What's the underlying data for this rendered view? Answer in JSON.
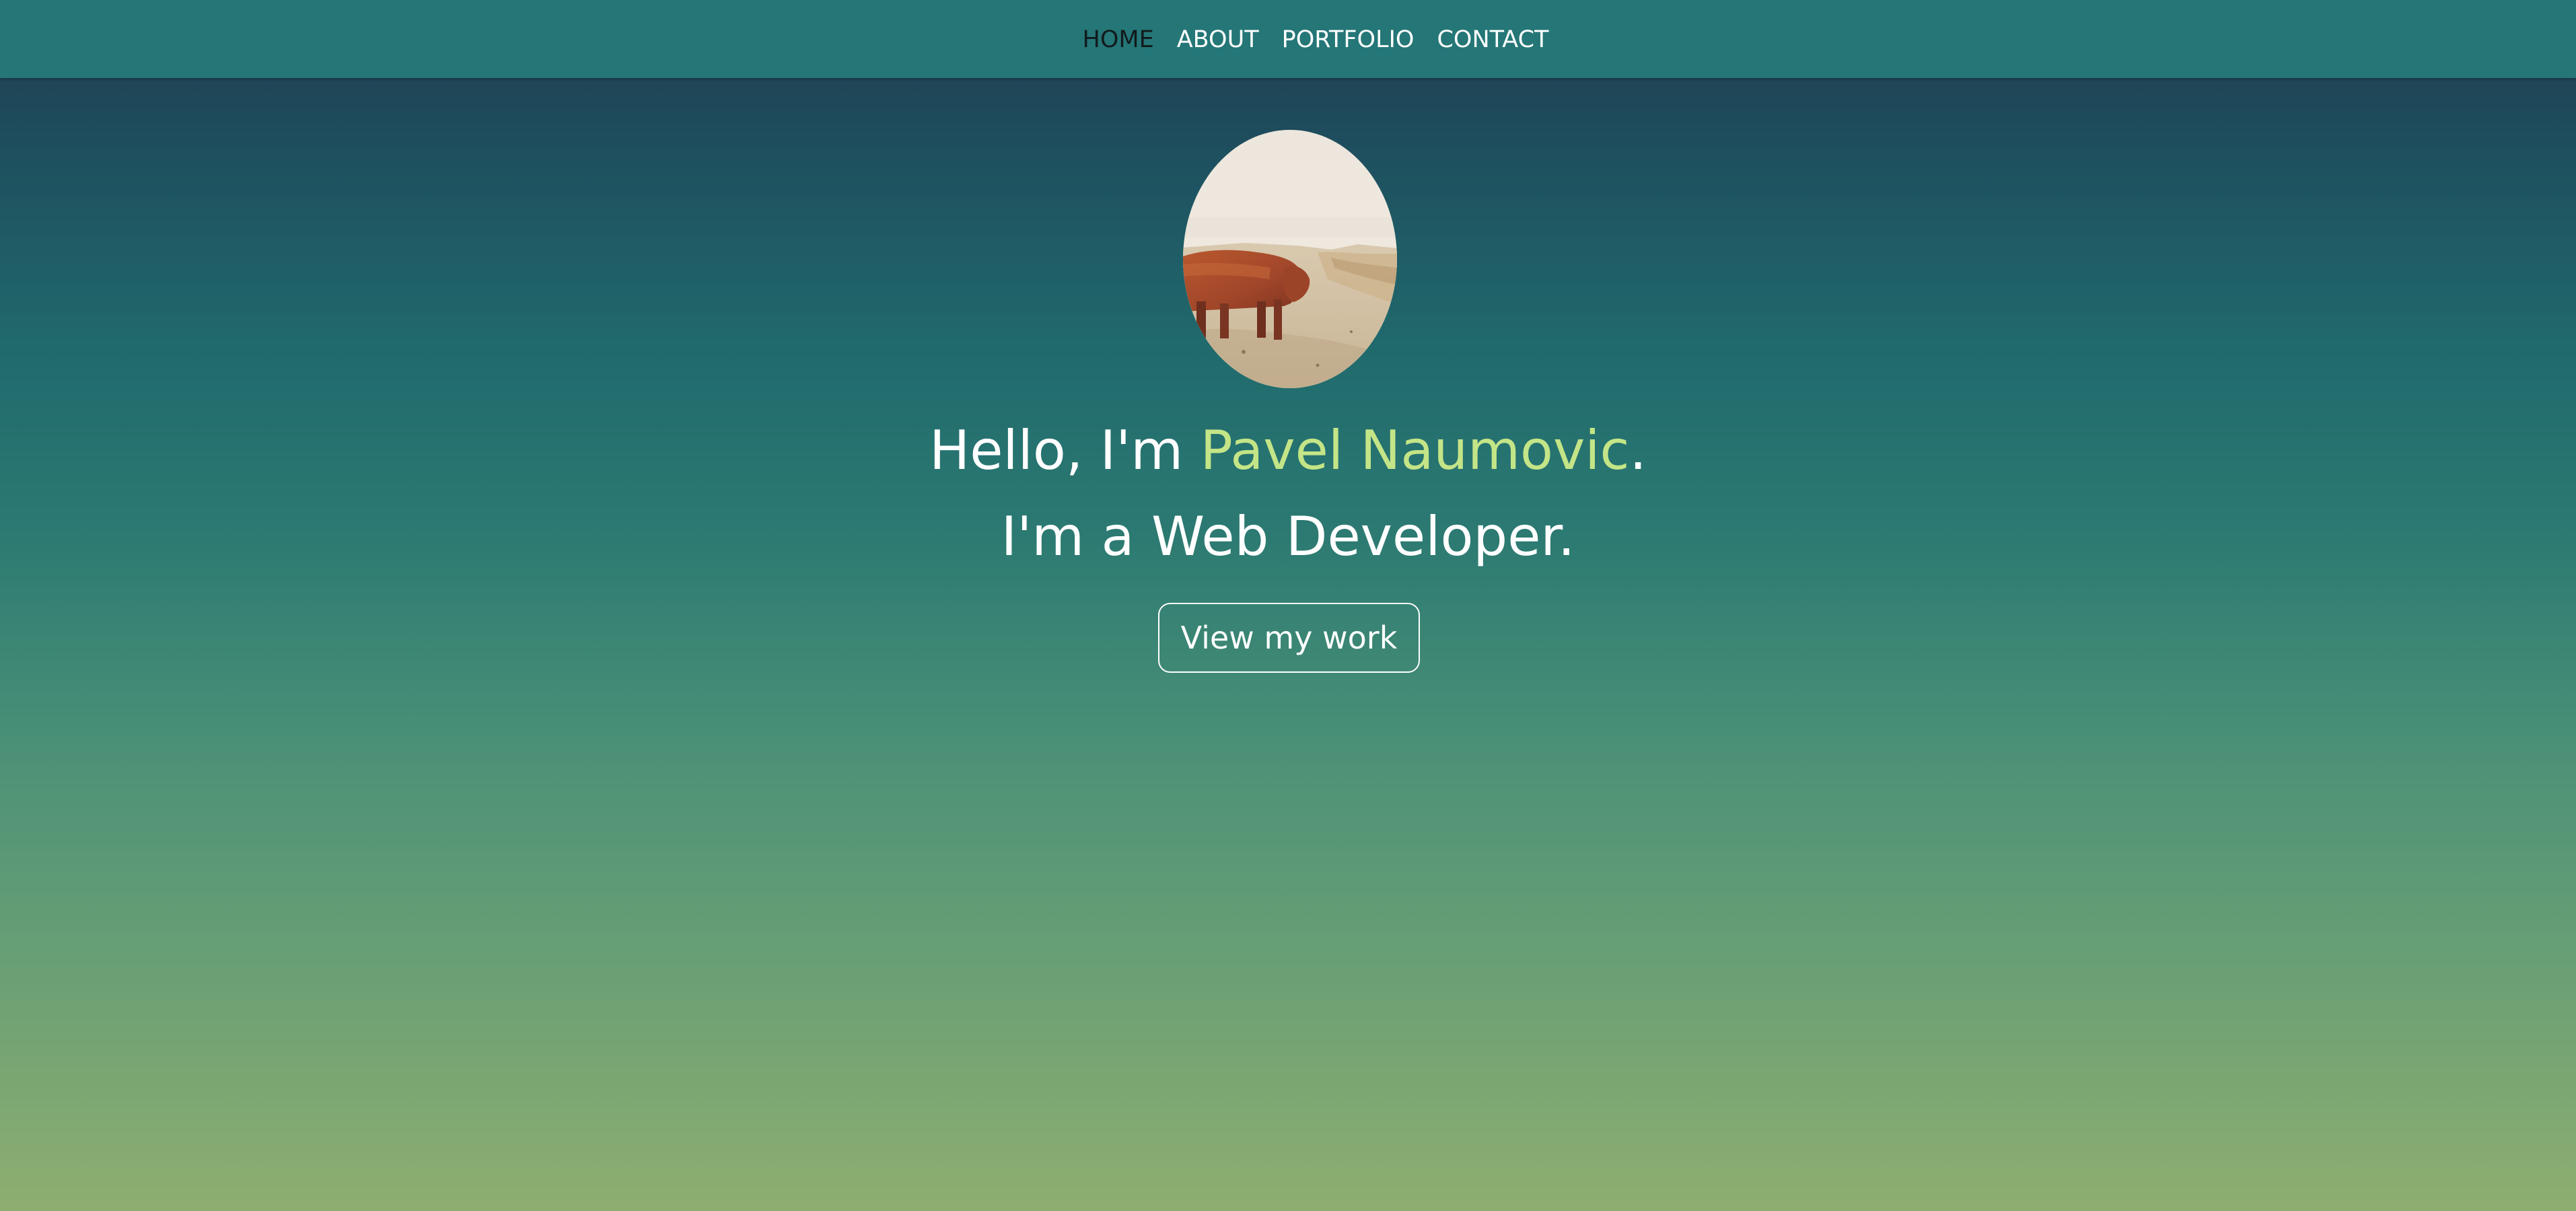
{
  "nav": {
    "items": [
      {
        "label": "HOME",
        "active": true
      },
      {
        "label": "ABOUT",
        "active": false
      },
      {
        "label": "PORTFOLIO",
        "active": false
      },
      {
        "label": "CONTACT",
        "active": false
      }
    ]
  },
  "hero": {
    "greeting_prefix": "Hello, I'm ",
    "name": "Pavel Naumovic",
    "greeting_suffix": ".",
    "role": "I'm a Web Developer.",
    "cta_label": "View my work",
    "avatar_subject": "highland cow on a sandy hill"
  },
  "colors": {
    "navbar": "#257677",
    "accent_name": "#c4e587",
    "active_nav": "#111a1c",
    "gradient_top": "#223a4e",
    "gradient_bottom": "#8eae70"
  }
}
